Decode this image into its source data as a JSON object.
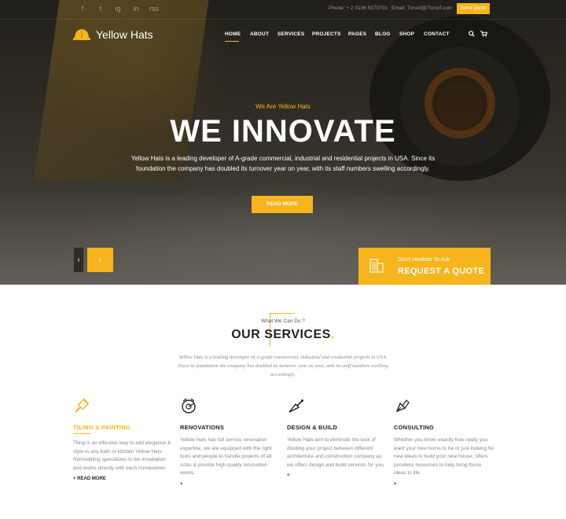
{
  "topbar": {
    "social": [
      "f",
      "t",
      "ig",
      "in",
      "rss"
    ],
    "phone_label": "Phone: + 2 0106 5370701",
    "email_label": "Email: 7oroof@7oroof.com",
    "quote_button": "Get A Quote"
  },
  "brand": {
    "name": "Yellow Hats"
  },
  "nav": {
    "items": [
      "HOME",
      "ABOUT",
      "SERVICES",
      "PROJECTS",
      "PAGES",
      "BLOG",
      "SHOP",
      "CONTACT"
    ],
    "active": "HOME"
  },
  "hero": {
    "eyebrow": "We Are Yellow Hats",
    "headline": "WE INNOVATE",
    "lead": "Yellow Hats is a leading developer of A-grade commercial, industrial and residential projects in USA. Since its foundation the company has doubled its turnover year on year, with its staff numbers swelling accordingly.",
    "read_more": "READ MORE",
    "prev": "‹",
    "next": "›"
  },
  "quote": {
    "small": "Don't Hesitate To Ask",
    "big": "REQUEST A QUOTE"
  },
  "services": {
    "eyebrow": "What We Can Do ?",
    "title": "OUR SERVICES",
    "dot": ".",
    "description": "Yellow Hats is a leading developer of A-grade commercial, industrial and residential projects in USA. Since its foundation the company has doubled its turnover year on year, with its staff numbers swelling accordingly.",
    "cards": [
      {
        "title": "TILING & PAINTING",
        "icon": "paint-brush-icon",
        "text": "Tiling is an effective way to add elegance & style to any bath or kitchen Yellow Hats Remodeling specializes in tile installation and works directly with each homeowner.",
        "more": "+ READ MORE"
      },
      {
        "title": "RENOVATIONS",
        "icon": "saw-blade-icon",
        "text": "Yellow Hats has full service renovation expertise, we are equipped with the right tools and people to handle projects of all sizes & provide high quality renovation works.",
        "more": "+"
      },
      {
        "title": "DESIGN & BUILD",
        "icon": "trowel-icon",
        "text": "Yellow Hats aim to eliminate the task of dividing your project between different architecture and construction company as we offers design and build services for you.",
        "more": "+"
      },
      {
        "title": "CONSULTING",
        "icon": "pen-nib-icon",
        "text": "Whether you know exactly how really you want your new home to be or just looking for new ideas to build your new house, offers priceless resources to help bring those ideas to life.",
        "more": "+"
      }
    ]
  },
  "colors": {
    "accent": "#f6b41d",
    "dark": "#222222"
  }
}
